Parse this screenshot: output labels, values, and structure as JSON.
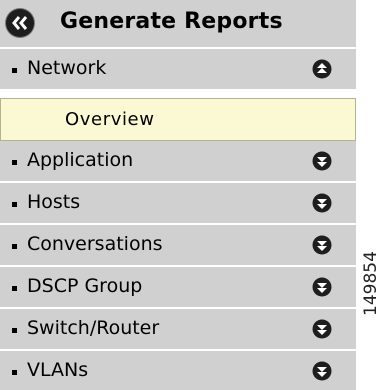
{
  "panel": {
    "title": "Generate Reports",
    "collapse_icon": "double-chevron-left-icon"
  },
  "menu": {
    "items": [
      {
        "label": "Network",
        "expanded": true,
        "toggle_icon": "double-chevron-up-icon"
      },
      {
        "label": "Application",
        "expanded": false,
        "toggle_icon": "double-chevron-down-icon"
      },
      {
        "label": "Hosts",
        "expanded": false,
        "toggle_icon": "double-chevron-down-icon"
      },
      {
        "label": "Conversations",
        "expanded": false,
        "toggle_icon": "double-chevron-down-icon"
      },
      {
        "label": "DSCP Group",
        "expanded": false,
        "toggle_icon": "double-chevron-down-icon"
      },
      {
        "label": "Switch/Router",
        "expanded": false,
        "toggle_icon": "double-chevron-down-icon"
      },
      {
        "label": "VLANs",
        "expanded": false,
        "toggle_icon": "double-chevron-down-icon"
      }
    ],
    "network_subitems": [
      {
        "label": "Overview",
        "highlighted": true
      }
    ]
  },
  "figure_id": "149854",
  "colors": {
    "panel_gray": "#d0d0d0",
    "subitem_highlight": "#fbf8d4",
    "icon_dark": "#1e1e1e"
  }
}
